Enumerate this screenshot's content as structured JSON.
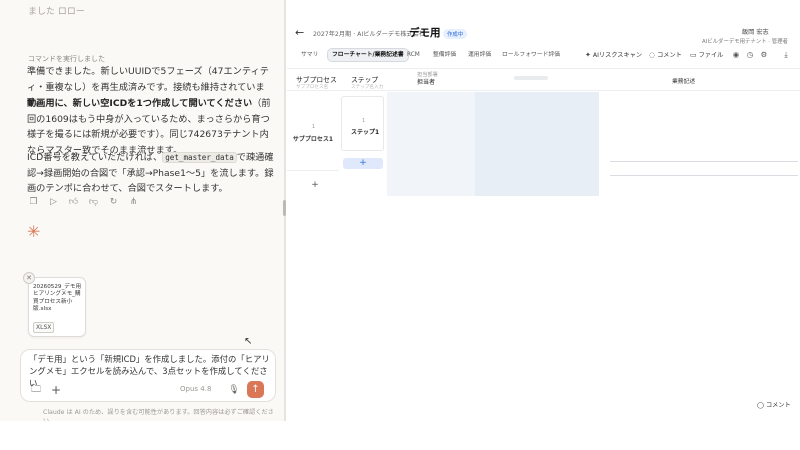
{
  "chat": {
    "top_fade": "ました ロロー",
    "command_note": "コマンドを実行しました",
    "p1": "準備できました。新しいUUIDで5フェーズ（47エンティティ・重複なし）を再生成済みです。接続も維持されています。",
    "p2_bold": "動画用に、新しい空ICDを1つ作成して開いてください",
    "p2_rest": "（前回の1609はもう中身が入っているため、まっさらから育つ様子を撮るには新規が必要です）。同じ742673テナント内ならマスター致でそのまま流せます。",
    "p3_pre": "ICD番号を教えていただければ、",
    "p3_code": "get_master_data",
    "p3_post": "で疎通確認→録画開始の合図で「承認→Phase1〜5」を流します。録画のテンポに合わせて、合図でスタートします。",
    "actions": [
      "copy-icon",
      "play-icon",
      "thumbs-up-icon",
      "thumbs-down-icon",
      "retry-icon",
      "share-icon"
    ],
    "attachment": {
      "name": "20260529_デモ用ヒアリングメモ_購買プロセス新小版.xlsx",
      "type": "XLSX"
    },
    "composer": {
      "text": "「デモ用」という「新規ICD」を作成しました。添付の「ヒアリングメモ」エクセルを読み込んで、3点セットを作成してください",
      "model": "Opus 4.8"
    },
    "disclaimer": "Claude は AI のため、誤りを含む可能性があります。回答内容は必ずご確認ください。",
    "accent_color": "#d97757"
  },
  "app": {
    "breadcrumb": "2027年2月期 · AIビルダーデモ株式会社",
    "title": "デモ用",
    "status": "作成中",
    "user_name": "飯岡 宏志",
    "user_org": "AIビルダーデモ用テナント · 管理者",
    "tabs": [
      {
        "label": "サマリ",
        "active": false
      },
      {
        "label": "フローチャート/業務記述書",
        "active": true
      },
      {
        "label": "RCM",
        "active": false
      },
      {
        "label": "整備評価",
        "active": false
      },
      {
        "label": "運用評価",
        "active": false
      },
      {
        "label": "ロールフォワード評価",
        "active": false
      }
    ],
    "tools": {
      "ai_scan": "AIリスクスキャン",
      "comment": "コメント",
      "file": "ファイル"
    },
    "columns": {
      "subprocess": "サブプロセス",
      "subprocess_hint": "サブプロセス名",
      "step": "ステップ",
      "step_hint": "ステップ名入力",
      "mid_top": "担当部署",
      "mid_bottom": "担当者",
      "right": "業務記述"
    },
    "row": {
      "subprocess_number": "1",
      "subprocess_label": "サブプロセス1",
      "step_number": "1",
      "step_label": "ステップ1"
    },
    "add_step": "+",
    "add_subprocess": "+",
    "comment_button": "コメント",
    "accent_color": "#2f6fe0"
  }
}
